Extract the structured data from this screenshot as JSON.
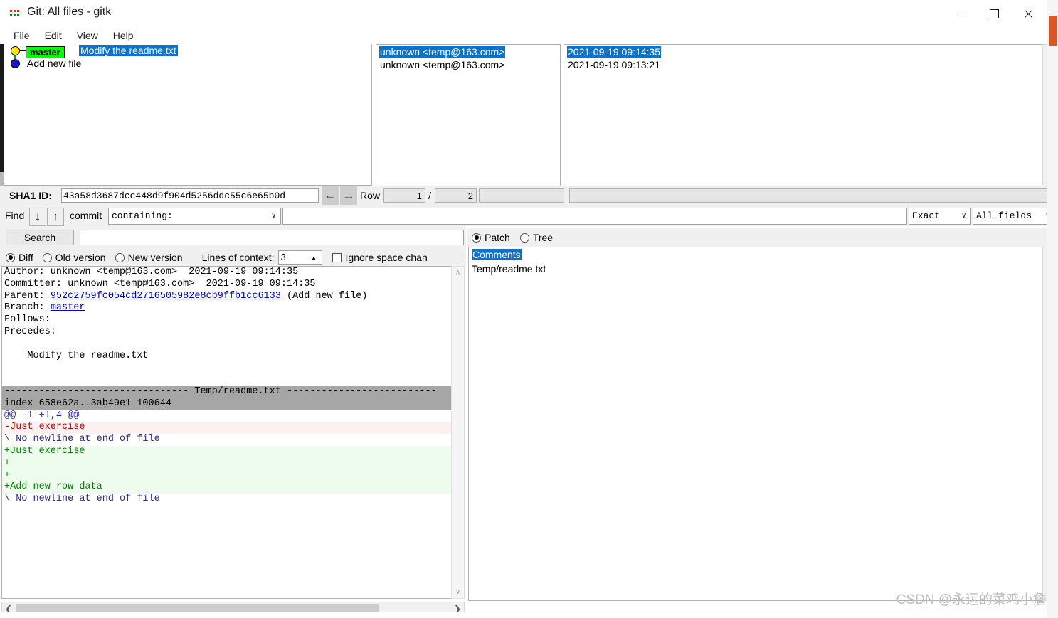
{
  "window": {
    "title": "Git: All files - gitk",
    "icon": "gitk-icon",
    "minimize": "—",
    "maximize": "□",
    "close": "✕"
  },
  "menu": {
    "items": [
      {
        "label": "File"
      },
      {
        "label": "Edit"
      },
      {
        "label": "View"
      },
      {
        "label": "Help"
      }
    ]
  },
  "commit_list": {
    "columns": [
      "",
      "",
      ""
    ],
    "rows": [
      {
        "branch_tag": "master",
        "subject": "Modify the readme.txt",
        "author": "unknown <temp@163.com>",
        "date": "2021-09-19 09:14:35",
        "selected": true
      },
      {
        "branch_tag": "",
        "subject": "Add new file",
        "author": "unknown <temp@163.com>",
        "date": "2021-09-19 09:13:21",
        "selected": false
      }
    ]
  },
  "sha_row": {
    "label": "SHA1 ID:",
    "value": "43a58d3687dcc448d9f904d5256ddc55c6e65b0d",
    "back_icon": "←",
    "forward_icon": "→",
    "row_label": "Row",
    "row_current": "1",
    "row_separator": "/",
    "row_total": "2",
    "row_extra": ""
  },
  "find_row": {
    "label": "Find",
    "down_icon": "↓",
    "up_icon": "↑",
    "commit_label": "commit",
    "mode_value": "containing:",
    "caret": "∨",
    "query": "",
    "exact_value": "Exact",
    "fields_value": "All fields"
  },
  "search_row": {
    "button_label": "Search",
    "query": ""
  },
  "options_row": {
    "diff_label": "Diff",
    "old_label": "Old version",
    "new_label": "New version",
    "selected_mode": "Diff",
    "context_label": "Lines of context:",
    "context_value": "3",
    "spin_up": "▲",
    "spin_down": "▼",
    "ignore_space_label": "Ignore space chan",
    "ignore_space_checked": false
  },
  "view_mode": {
    "patch_label": "Patch",
    "tree_label": "Tree",
    "selected": "Patch"
  },
  "file_list": {
    "items": [
      {
        "label": "Comments",
        "selected": true
      },
      {
        "label": "Temp/readme.txt",
        "selected": false
      }
    ]
  },
  "diff": {
    "lines": [
      {
        "type": "plain",
        "segments": [
          {
            "text": "Author: unknown <temp@163.com>  2021-09-19 09:14:35",
            "style": "plain"
          }
        ]
      },
      {
        "type": "plain",
        "segments": [
          {
            "text": "Committer: unknown <temp@163.com>  2021-09-19 09:14:35",
            "style": "plain"
          }
        ]
      },
      {
        "type": "plain",
        "segments": [
          {
            "text": "Parent: ",
            "style": "plain"
          },
          {
            "text": "952c2759fc054cd2716505982e8cb9ffb1cc6133",
            "style": "link"
          },
          {
            "text": " (Add new file)",
            "style": "plain"
          }
        ]
      },
      {
        "type": "plain",
        "segments": [
          {
            "text": "Branch: ",
            "style": "plain"
          },
          {
            "text": "master",
            "style": "link"
          }
        ]
      },
      {
        "type": "plain",
        "segments": [
          {
            "text": "Follows:",
            "style": "plain"
          }
        ]
      },
      {
        "type": "plain",
        "segments": [
          {
            "text": "Precedes:",
            "style": "plain"
          }
        ]
      },
      {
        "type": "blank",
        "segments": [
          {
            "text": " ",
            "style": "plain"
          }
        ]
      },
      {
        "type": "plain",
        "segments": [
          {
            "text": "    Modify the readme.txt",
            "style": "plain"
          }
        ]
      },
      {
        "type": "blank",
        "segments": [
          {
            "text": " ",
            "style": "plain"
          }
        ]
      },
      {
        "type": "blank",
        "segments": [
          {
            "text": " ",
            "style": "plain"
          }
        ]
      },
      {
        "type": "file",
        "segments": [
          {
            "text": "-------------------------------- Temp/readme.txt --------------------------",
            "style": "file"
          }
        ]
      },
      {
        "type": "file",
        "segments": [
          {
            "text": "index 658e62a..3ab49e1 100644",
            "style": "file"
          }
        ]
      },
      {
        "type": "hunk",
        "segments": [
          {
            "text": "@@ -1 +1,4 @@",
            "style": "hunk"
          }
        ]
      },
      {
        "type": "del",
        "segments": [
          {
            "text": "-Just exercise",
            "style": "del"
          }
        ]
      },
      {
        "type": "nonl",
        "segments": [
          {
            "text": "\\ No newline at end of file",
            "style": "nonl"
          }
        ]
      },
      {
        "type": "add",
        "segments": [
          {
            "text": "+Just exercise",
            "style": "add"
          }
        ]
      },
      {
        "type": "add",
        "segments": [
          {
            "text": "+",
            "style": "add"
          }
        ]
      },
      {
        "type": "add",
        "segments": [
          {
            "text": "+",
            "style": "add"
          }
        ]
      },
      {
        "type": "add",
        "segments": [
          {
            "text": "+Add new row data",
            "style": "add"
          }
        ]
      },
      {
        "type": "nonl",
        "segments": [
          {
            "text": "\\ No newline at end of file",
            "style": "nonl"
          }
        ]
      }
    ]
  },
  "scrollbars": {
    "up_icon": "∧",
    "down_icon": "∨",
    "left_icon": "❮",
    "right_icon": "❯"
  },
  "watermark": {
    "text": "CSDN @永远的菜鸡小詹"
  },
  "colors": {
    "selection": "#0f72c8",
    "branch_tag": "#00ff00",
    "add": "#008000",
    "del": "#cc0000",
    "link": "#0000cc",
    "file_header": "#a6a6a6"
  }
}
